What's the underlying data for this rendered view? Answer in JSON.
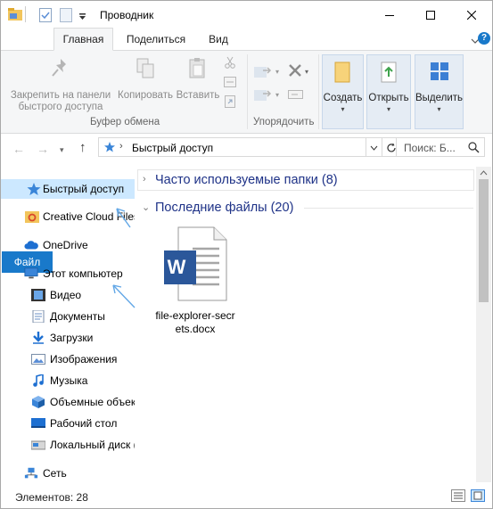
{
  "window": {
    "title": "Проводник"
  },
  "ribbon_tabs": [
    {
      "label": "Файл"
    },
    {
      "label": "Главная"
    },
    {
      "label": "Поделиться"
    },
    {
      "label": "Вид"
    }
  ],
  "clipboard": {
    "pin_label": "Закрепить на панели быстрого доступа",
    "copy_label": "Копировать",
    "paste_label": "Вставить",
    "group_label": "Буфер обмена"
  },
  "organize": {
    "group_label": "Упорядочить"
  },
  "actions": {
    "create_label": "Создать",
    "open_label": "Открыть",
    "select_label": "Выделить"
  },
  "address": {
    "path": "Быстрый доступ",
    "search_placeholder": "Поиск: Б..."
  },
  "nav": {
    "items": [
      {
        "label": "Быстрый доступ"
      },
      {
        "label": "Creative Cloud Files"
      },
      {
        "label": "OneDrive"
      },
      {
        "label": "Этот компьютер"
      },
      {
        "label": "Видео"
      },
      {
        "label": "Документы"
      },
      {
        "label": "Загрузки"
      },
      {
        "label": "Изображения"
      },
      {
        "label": "Музыка"
      },
      {
        "label": "Объемные объекты"
      },
      {
        "label": "Рабочий стол"
      },
      {
        "label": "Локальный диск (C:)"
      },
      {
        "label": "Сеть"
      }
    ]
  },
  "content": {
    "frequent_label": "Часто используемые папки (8)",
    "recent_label": "Последние файлы (20)",
    "file_name": "file-explorer-secrets.docx",
    "file_badge": "W"
  },
  "status": {
    "items_count": "Элементов: 28"
  },
  "colors": {
    "accent": "#1979ca",
    "selection": "#cce8ff",
    "word": "#2b579a"
  }
}
